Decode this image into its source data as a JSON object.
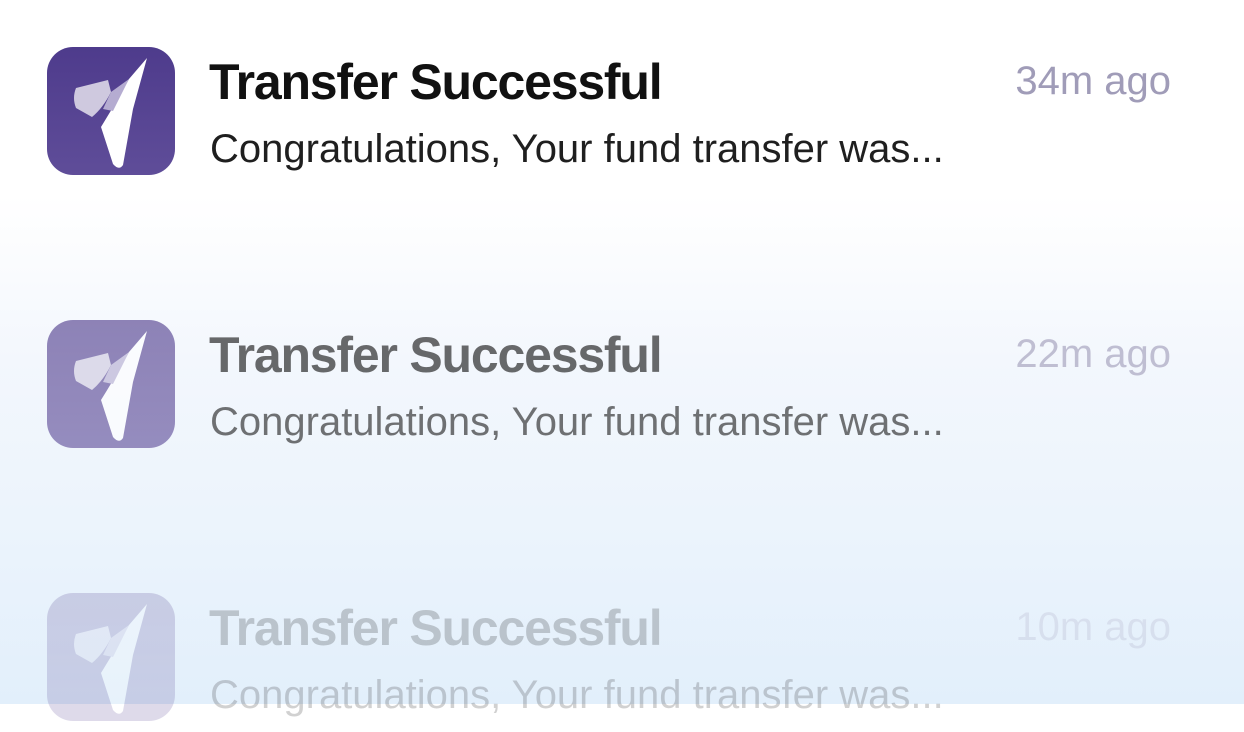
{
  "notifications": [
    {
      "title": "Transfer Successful",
      "time": "34m ago",
      "message": "Congratulations, Your fund transfer was..."
    },
    {
      "title": "Transfer Successful",
      "time": "22m ago",
      "message": "Congratulations, Your fund transfer was..."
    },
    {
      "title": "Transfer Successful",
      "time": "10m ago",
      "message": "Congratulations, Your fund transfer was..."
    }
  ],
  "app_icon": {
    "name": "paper-plane-app-icon",
    "background_color": "#4e3b8c",
    "mark_color": "#ffffff"
  }
}
